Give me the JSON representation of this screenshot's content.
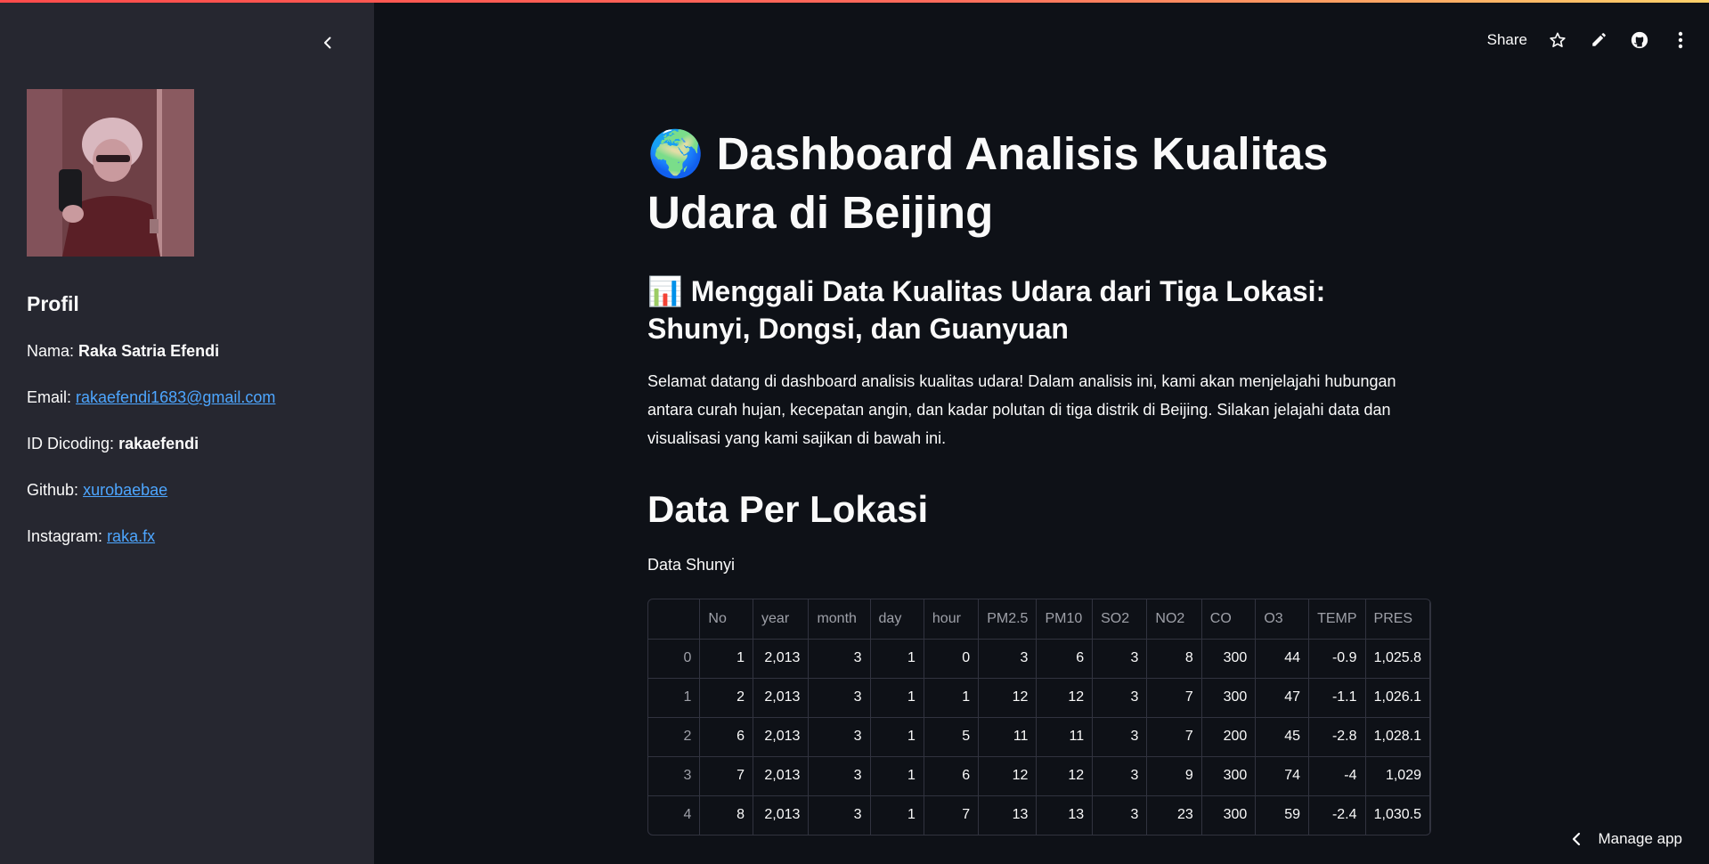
{
  "sidebar": {
    "profile_heading": "Profil",
    "nama_label": "Nama:",
    "nama_value": "Raka Satria Efendi",
    "email_label": "Email:",
    "email_value": "rakaefendi1683@gmail.com",
    "id_label": "ID Dicoding:",
    "id_value": "rakaefendi",
    "github_label": "Github:",
    "github_value": "xurobaebae",
    "instagram_label": "Instagram:",
    "instagram_value": "raka.fx"
  },
  "toolbar": {
    "share_label": "Share"
  },
  "main": {
    "title": "🌍 Dashboard Analisis Kualitas Udara di Beijing",
    "subtitle": "📊 Menggali Data Kualitas Udara dari Tiga Lokasi: Shunyi, Dongsi, dan Guanyuan",
    "intro": "Selamat datang di dashboard analisis kualitas udara! Dalam analisis ini, kami akan menjelajahi hubungan antara curah hujan, kecepatan angin, dan kadar polutan di tiga distrik di Beijing. Silakan jelajahi data dan visualisasi yang kami sajikan di bawah ini.",
    "section_heading": "Data Per Lokasi",
    "table_caption": "Data Shunyi"
  },
  "table": {
    "columns": [
      "",
      "No",
      "year",
      "month",
      "day",
      "hour",
      "PM2.5",
      "PM10",
      "SO2",
      "NO2",
      "CO",
      "O3",
      "TEMP",
      "PRES"
    ],
    "rows": [
      [
        "0",
        "1",
        "2,013",
        "3",
        "1",
        "0",
        "3",
        "6",
        "3",
        "8",
        "300",
        "44",
        "-0.9",
        "1,025.8"
      ],
      [
        "1",
        "2",
        "2,013",
        "3",
        "1",
        "1",
        "12",
        "12",
        "3",
        "7",
        "300",
        "47",
        "-1.1",
        "1,026.1"
      ],
      [
        "2",
        "6",
        "2,013",
        "3",
        "1",
        "5",
        "11",
        "11",
        "3",
        "7",
        "200",
        "45",
        "-2.8",
        "1,028.1"
      ],
      [
        "3",
        "7",
        "2,013",
        "3",
        "1",
        "6",
        "12",
        "12",
        "3",
        "9",
        "300",
        "74",
        "-4",
        "1,029"
      ],
      [
        "4",
        "8",
        "2,013",
        "3",
        "1",
        "7",
        "13",
        "13",
        "3",
        "23",
        "300",
        "59",
        "-2.4",
        "1,030.5"
      ]
    ]
  },
  "footer": {
    "manage_label": "Manage app"
  },
  "icons": {
    "collapse": "chevron-left-icon",
    "star": "star-icon",
    "edit": "pencil-icon",
    "github": "github-icon",
    "menu": "more-vertical-icon",
    "manage": "chevron-left-icon"
  },
  "colors": {
    "background": "#0e1117",
    "sidebar": "#262730",
    "link": "#4da6ff",
    "accent_gradient_start": "#ff4b4b",
    "accent_gradient_end": "#ffd16a"
  }
}
